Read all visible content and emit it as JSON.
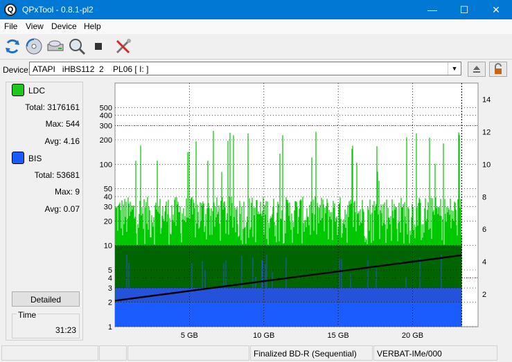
{
  "window": {
    "title": "QPxTool - 0.8.1-pl2",
    "icon_letter": "Q"
  },
  "menu": {
    "items": [
      "File",
      "View",
      "Device",
      "Help"
    ]
  },
  "toolbar": {
    "icons": [
      "refresh-icon",
      "disc-scan-icon",
      "drive-icon",
      "search-icon",
      "stop-icon",
      "tools-icon"
    ]
  },
  "device": {
    "label": "Device:",
    "value": "ATAPI   iHBS112  2    PL06 [ I: ]"
  },
  "stats": {
    "ldc": {
      "name": "LDC",
      "color": "#1ec81e",
      "total_label": "Total:",
      "total": "3176161",
      "max_label": "Max:",
      "max": "544",
      "avg_label": "Avg:",
      "avg": "4.16"
    },
    "bis": {
      "name": "BIS",
      "color": "#1a5cff",
      "total_label": "Total:",
      "total": "53681",
      "max_label": "Max:",
      "max": "9",
      "avg_label": "Avg:",
      "avg": "0.07"
    }
  },
  "detailed_label": "Detailed",
  "time": {
    "label": "Time",
    "value": "31:23"
  },
  "status": {
    "disc_type": "Finalized BD-R (Sequential)",
    "media_id": "VERBAT-IMe/000"
  },
  "chart_data": {
    "type": "area",
    "x_unit": "GB",
    "x_ticks": [
      "5 GB",
      "10 GB",
      "15 GB",
      "20 GB"
    ],
    "x_tick_values": [
      5,
      10,
      15,
      20
    ],
    "xlim": [
      0,
      24.4
    ],
    "y_left_ticks": [
      "500",
      "400",
      "300",
      "200",
      "100",
      "50",
      "40",
      "30",
      "20",
      "10",
      "5",
      "4",
      "3",
      "2",
      "1"
    ],
    "y_left_tick_values": [
      500,
      400,
      300,
      200,
      100,
      50,
      40,
      30,
      20,
      10,
      5,
      4,
      3,
      2,
      1
    ],
    "y_left_scale": "log",
    "y_left_lim": [
      1,
      1000
    ],
    "y_right_ticks": [
      "14",
      "12",
      "10",
      "8",
      "6",
      "4",
      "2"
    ],
    "y_right_tick_values": [
      14,
      12,
      10,
      8,
      6,
      4,
      2
    ],
    "y_right_lim": [
      0,
      15
    ],
    "grid": true,
    "disc_end_gb": 23.3,
    "series": [
      {
        "name": "LDC",
        "color": "#00c800",
        "typical_range": [
          10,
          40
        ],
        "max": 544
      },
      {
        "name": "BIS",
        "color": "#1a5cff",
        "typical": 2,
        "max": 9
      },
      {
        "color": "#000000",
        "x": [
          0,
          23.3
        ],
        "y_right": [
          1.6,
          4.4
        ]
      }
    ],
    "threshold_left": 300,
    "threshold_right": 12
  }
}
